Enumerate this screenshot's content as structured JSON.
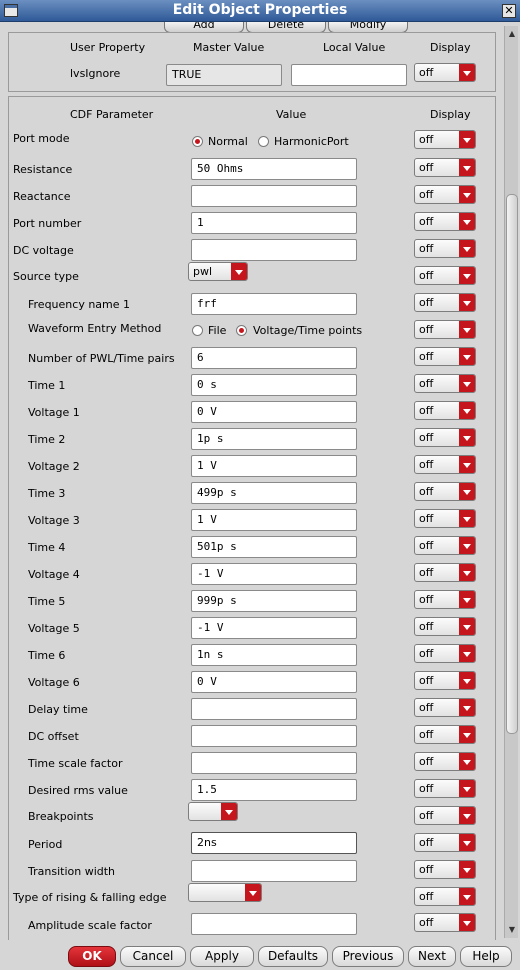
{
  "window": {
    "title": "Edit Object Properties"
  },
  "top_buttons": {
    "add": "Add",
    "delete": "Delete",
    "modify": "Modify"
  },
  "user_props": {
    "headers": {
      "user_property": "User Property",
      "master_value": "Master Value",
      "local_value": "Local Value",
      "display": "Display"
    },
    "name": "lvsIgnore",
    "master_value": "TRUE",
    "local_value": "",
    "display": "off"
  },
  "cdf": {
    "headers": {
      "param": "CDF Parameter",
      "value": "Value",
      "display": "Display"
    },
    "port_mode": {
      "label": "Port mode",
      "opt1": "Normal",
      "opt2": "HarmonicPort",
      "selected": "Normal",
      "display": "off"
    },
    "resistance": {
      "label": "Resistance",
      "value": "50 Ohms",
      "display": "off"
    },
    "reactance": {
      "label": "Reactance",
      "value": "",
      "display": "off"
    },
    "port_number": {
      "label": "Port number",
      "value": "1",
      "display": "off"
    },
    "dc_voltage": {
      "label": "DC voltage",
      "value": "",
      "display": "off"
    },
    "source_type": {
      "label": "Source type",
      "value": "pwl",
      "display": "off"
    },
    "freq_name": {
      "label": "Frequency name 1",
      "value": "frf",
      "display": "off"
    },
    "waveform": {
      "label": "Waveform Entry Method",
      "opt1": "File",
      "opt2": "Voltage/Time points",
      "selected": "Voltage/Time points",
      "display": "off"
    },
    "num_pairs": {
      "label": "Number of PWL/Time pairs",
      "value": "6",
      "display": "off"
    },
    "pairs": [
      {
        "label": "Time 1",
        "value": "0 s",
        "display": "off"
      },
      {
        "label": "Voltage 1",
        "value": "0 V",
        "display": "off"
      },
      {
        "label": "Time 2",
        "value": "1p s",
        "display": "off"
      },
      {
        "label": "Voltage 2",
        "value": "1 V",
        "display": "off"
      },
      {
        "label": "Time 3",
        "value": "499p s",
        "display": "off"
      },
      {
        "label": "Voltage 3",
        "value": "1 V",
        "display": "off"
      },
      {
        "label": "Time 4",
        "value": "501p s",
        "display": "off"
      },
      {
        "label": "Voltage 4",
        "value": "-1 V",
        "display": "off"
      },
      {
        "label": "Time 5",
        "value": "999p s",
        "display": "off"
      },
      {
        "label": "Voltage 5",
        "value": "-1 V",
        "display": "off"
      },
      {
        "label": "Time 6",
        "value": "1n s",
        "display": "off"
      },
      {
        "label": "Voltage 6",
        "value": "0 V",
        "display": "off"
      }
    ],
    "delay_time": {
      "label": "Delay time",
      "value": "",
      "display": "off"
    },
    "dc_offset": {
      "label": "DC offset",
      "value": "",
      "display": "off"
    },
    "time_scale": {
      "label": "Time scale factor",
      "value": "",
      "display": "off"
    },
    "rms": {
      "label": "Desired rms value",
      "value": "1.5",
      "display": "off"
    },
    "breakpoints": {
      "label": "Breakpoints",
      "value": "",
      "display": "off"
    },
    "period": {
      "label": "Period",
      "value": "2ns",
      "display": "off"
    },
    "transition": {
      "label": "Transition width",
      "value": "",
      "display": "off"
    },
    "edge_type": {
      "label": "Type of rising & falling edge",
      "value": "",
      "display": "off"
    },
    "amp_scale": {
      "label": "Amplitude scale factor",
      "value": "",
      "display": "off"
    }
  },
  "buttons": {
    "ok": "OK",
    "cancel": "Cancel",
    "apply": "Apply",
    "defaults": "Defaults",
    "previous": "Previous",
    "next": "Next",
    "help": "Help"
  }
}
